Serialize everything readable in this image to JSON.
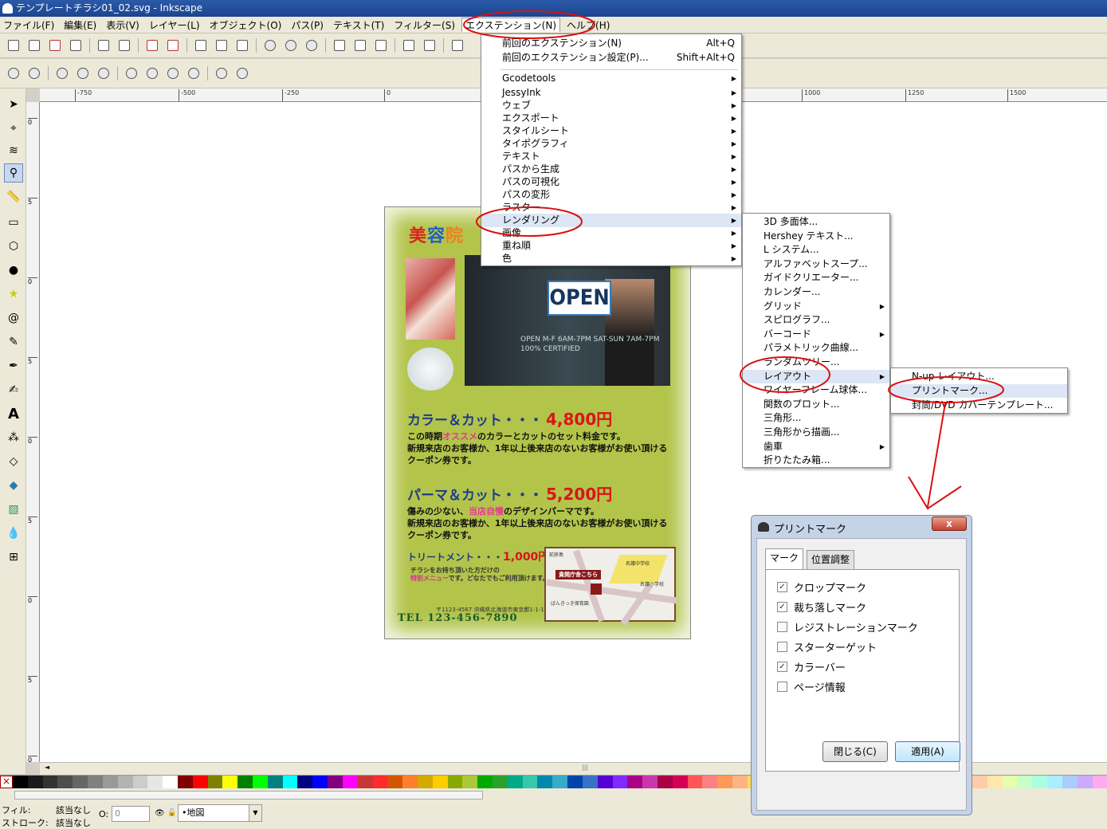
{
  "window": {
    "title": "テンプレートチラシ01_02.svg - Inkscape"
  },
  "menubar": [
    "ファイル(F)",
    "編集(E)",
    "表示(V)",
    "レイヤー(L)",
    "オブジェクト(O)",
    "パス(P)",
    "テキスト(T)",
    "フィルター(S)",
    "エクステンション(N)",
    "ヘルプ(H)"
  ],
  "ruler": {
    "h_labels": [
      "-750",
      "-500",
      "-250",
      "0",
      "1000",
      "1250",
      "1500"
    ],
    "v_labels": [
      "0",
      "5",
      "0",
      "5",
      "0",
      "5",
      "0",
      "5",
      "0"
    ]
  },
  "extensions_menu": {
    "top": [
      {
        "label": "前回のエクステンション(N)",
        "shortcut": "Alt+Q"
      },
      {
        "label": "前回のエクステンション設定(P)...",
        "shortcut": "Shift+Alt+Q"
      }
    ],
    "items": [
      "Gcodetools",
      "JessyInk",
      "ウェブ",
      "エクスポート",
      "スタイルシート",
      "タイポグラフィ",
      "テキスト",
      "パスから生成",
      "パスの可視化",
      "パスの変形",
      "ラスター",
      "レンダリング",
      "画像",
      "重ね順",
      "色"
    ]
  },
  "render_menu": {
    "items": [
      "3D 多面体...",
      "Hershey テキスト...",
      "L システム...",
      "アルファベットスープ...",
      "ガイドクリエーター...",
      "カレンダー...",
      "グリッド",
      "スピログラフ...",
      "バーコード",
      "パラメトリック曲線...",
      "ランダムツリー...",
      "レイアウト",
      "ワイヤーフレーム球体...",
      "関数のプロット...",
      "三角形...",
      "三角形から描画...",
      "歯車",
      "折りたたみ箱..."
    ],
    "submenu_items": [
      "グリッド",
      "バーコード",
      "レイアウト",
      "歯車"
    ]
  },
  "layout_menu": {
    "items": [
      "N-up レイアウト...",
      "プリントマーク...",
      "封筒/DVD カバーテンプレート..."
    ]
  },
  "dialog": {
    "title": "プリントマーク",
    "close": "x",
    "tabs": [
      "マーク",
      "位置調整"
    ],
    "options": [
      {
        "label": "クロップマーク",
        "checked": true
      },
      {
        "label": "裁ち落しマーク",
        "checked": true
      },
      {
        "label": "レジストレーションマーク",
        "checked": false
      },
      {
        "label": "スターターゲット",
        "checked": false
      },
      {
        "label": "カラーバー",
        "checked": true
      },
      {
        "label": "ページ情報",
        "checked": false
      }
    ],
    "buttons": {
      "close": "閉じる(C)",
      "apply": "適用(A)"
    }
  },
  "flyer": {
    "title": [
      "美",
      "容",
      "院"
    ],
    "title_colors": [
      "#e02020",
      "#2060c0",
      "#f08020"
    ],
    "open_sign": "OPEN",
    "hours": [
      "OPEN M-F 6AM-7PM SAT-SUN 7AM-7PM",
      "100% CERTIFIED"
    ],
    "sec1": {
      "title": "カラー＆カット・・・",
      "price": "4,800円",
      "line1_pre": "この時期",
      "line1_em": "オススメ",
      "line1_post": "のカラーとカットのセット料金です。",
      "line2": "新規来店のお客様か、1年以上後来店のないお客様がお使い頂ける",
      "line3": "クーポン券です。"
    },
    "sec2": {
      "title": "パーマ＆カット・・・",
      "price": "5,200円",
      "line1_pre": "傷みの少ない、",
      "line1_em": "当店自慢",
      "line1_post": "のデザインパーマです。",
      "line2": "新規来店のお客様か、1年以上後来店のないお客様がお使い頂ける",
      "line3": "クーポン券です。"
    },
    "treatment": {
      "title": "トリートメント・・・",
      "price": "1,000円"
    },
    "note": {
      "line1": "チラシをお持ち頂いた方だけの",
      "line2_em": "特別メニュー",
      "line2_post": "です。どなたでもご利用頂けます。"
    },
    "address": "〒1123-4567 沖縄県北海道市東京都1-1-1",
    "tel": "TEL 123-456-7890",
    "map": {
      "pin": "貴開庁舎こちら",
      "label1": "前狭島",
      "label2": "名護中学校",
      "label3": "名護小学校",
      "label4": "ばんきっき保育園"
    }
  },
  "status": {
    "fill_label": "フィル:",
    "fill_value": "該当なし",
    "stroke_label": "ストローク:",
    "stroke_value": "該当なし",
    "opacity_label": "O:",
    "opacity_value": "0",
    "layer": "•地図"
  },
  "palette": [
    "#000000",
    "#1a1a1a",
    "#333333",
    "#4d4d4d",
    "#666666",
    "#808080",
    "#999999",
    "#b3b3b3",
    "#cccccc",
    "#e6e6e6",
    "#ffffff",
    "#800000",
    "#ff0000",
    "#808000",
    "#ffff00",
    "#008000",
    "#00ff00",
    "#008080",
    "#00ffff",
    "#000080",
    "#0000ff",
    "#800080",
    "#ff00ff",
    "#c83737",
    "#ff2a2a",
    "#d45500",
    "#ff7f2a",
    "#d4aa00",
    "#ffcc00",
    "#88aa00",
    "#abc837",
    "#00aa00",
    "#2ca02c",
    "#00aa88",
    "#37c8ab",
    "#0088aa",
    "#37abc8",
    "#0044aa",
    "#3771c8",
    "#5500d4",
    "#7f2aff",
    "#aa0088",
    "#c837ab",
    "#aa0044",
    "#d40055",
    "#ff5555",
    "#ff8080",
    "#ff9955",
    "#ffb380",
    "#ffdd55",
    "#ffe680",
    "#ccff66",
    "#aaff80",
    "#66ff99",
    "#80ffcc",
    "#55ddff",
    "#80e5ff",
    "#5599ff",
    "#80b3ff",
    "#aa87de",
    "#d5b3ff",
    "#ff80e5",
    "#ffb3d9",
    "#ffaaaa",
    "#ffccaa",
    "#ffe6aa",
    "#e5ffaa",
    "#c8ffc8",
    "#aaffdd",
    "#aaeeff",
    "#aaccff",
    "#ccaaff",
    "#ffaaee"
  ]
}
